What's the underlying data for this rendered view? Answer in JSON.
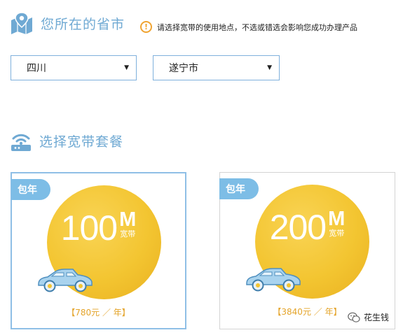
{
  "location": {
    "title": "您所在的省市",
    "hint": "请选择宽带的使用地点，不选或错选会影响您成功办理产品",
    "hint_icon": "!",
    "province": "四川",
    "city": "遂宁市"
  },
  "packages": {
    "title": "选择宽带套餐",
    "items": [
      {
        "badge": "包年",
        "speed": "100",
        "unit": "M",
        "unit_label": "宽带",
        "price": "【780元 ／ 年】"
      },
      {
        "badge": "包年",
        "speed": "200",
        "unit": "M",
        "unit_label": "宽带",
        "price": "【3840元 ／ 年】"
      }
    ]
  },
  "watermark": "花生钱",
  "colors": {
    "accent_blue": "#6fa9d3",
    "badge_blue": "#7dbde6",
    "circle_gold": "#f3c531",
    "price_orange": "#e4a42a",
    "hint_orange": "#f0a431"
  }
}
